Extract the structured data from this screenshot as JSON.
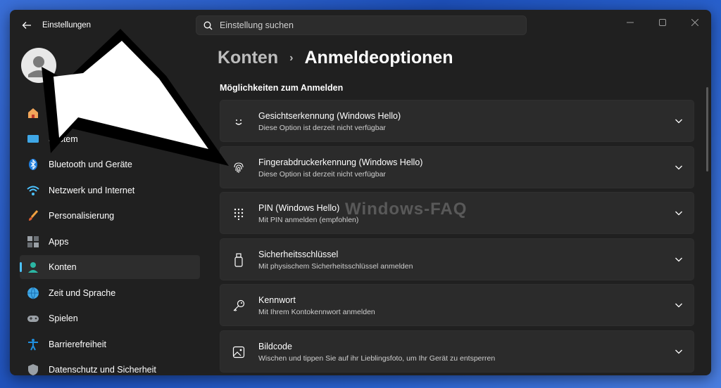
{
  "window": {
    "title": "Einstellungen"
  },
  "search": {
    "placeholder": "Einstellung suchen"
  },
  "sidebar": {
    "items": [
      {
        "label": "Startseite",
        "icon": "home-icon"
      },
      {
        "label": "System",
        "icon": "system-icon"
      },
      {
        "label": "Bluetooth und Geräte",
        "icon": "bluetooth-icon"
      },
      {
        "label": "Netzwerk und Internet",
        "icon": "network-icon"
      },
      {
        "label": "Personalisierung",
        "icon": "brush-icon"
      },
      {
        "label": "Apps",
        "icon": "apps-icon"
      },
      {
        "label": "Konten",
        "icon": "account-icon",
        "active": true
      },
      {
        "label": "Zeit und Sprache",
        "icon": "globe-icon"
      },
      {
        "label": "Spielen",
        "icon": "gamepad-icon"
      },
      {
        "label": "Barrierefreiheit",
        "icon": "accessibility-icon"
      },
      {
        "label": "Datenschutz und Sicherheit",
        "icon": "shield-icon"
      }
    ]
  },
  "breadcrumb": {
    "parent": "Konten",
    "separator": "›",
    "current": "Anmeldeoptionen"
  },
  "main": {
    "section_title": "Möglichkeiten zum Anmelden",
    "options": [
      {
        "title": "Gesichtserkennung (Windows Hello)",
        "subtitle": "Diese Option ist derzeit nicht verfügbar",
        "icon": "face-icon"
      },
      {
        "title": "Fingerabdruckerkennung (Windows Hello)",
        "subtitle": "Diese Option ist derzeit nicht verfügbar",
        "icon": "fingerprint-icon"
      },
      {
        "title": "PIN (Windows Hello)",
        "subtitle": "Mit PIN anmelden (empfohlen)",
        "icon": "keypad-icon"
      },
      {
        "title": "Sicherheitsschlüssel",
        "subtitle": "Mit physischem Sicherheitsschlüssel anmelden",
        "icon": "usb-key-icon"
      },
      {
        "title": "Kennwort",
        "subtitle": "Mit Ihrem Kontokennwort anmelden",
        "icon": "key-icon"
      },
      {
        "title": "Bildcode",
        "subtitle": "Wischen und tippen Sie auf ihr Lieblingsfoto, um Ihr Gerät zu entsperren",
        "icon": "picture-icon"
      }
    ]
  },
  "watermark": "Windows-FAQ",
  "colors": {
    "accent": "#4cc2ff",
    "window_bg": "#202020",
    "card_bg": "#2b2b2b"
  }
}
